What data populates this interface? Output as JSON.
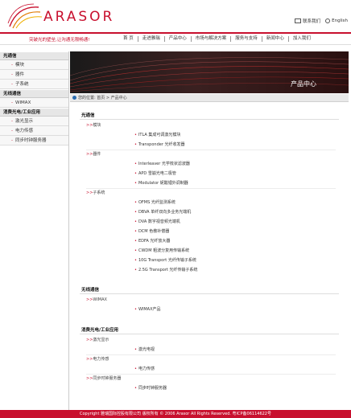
{
  "brand": {
    "logo_text": "ARASOR"
  },
  "top_links": {
    "contact": "联系我们",
    "english": "English"
  },
  "slogan": "突破光的壁垒,让沟通无限畅通!",
  "nav": [
    "首 页",
    "走进雅瑞",
    "产品中心",
    "市场与解决方案",
    "服务与支持",
    "新闻中心",
    "加入我们"
  ],
  "sidebar": {
    "groups": [
      {
        "title": "光通信",
        "items": [
          "模块",
          "器件",
          "子系统"
        ]
      },
      {
        "title": "无线通信",
        "items": [
          "WIMAX"
        ]
      },
      {
        "title": "消费光电/工业应用",
        "items": [
          "激光显示",
          "电力传感",
          "同步时钟服务器"
        ]
      }
    ]
  },
  "banner": {
    "title": "产品中心"
  },
  "breadcrumb": "您的位置: 首页 > 产品中心",
  "content": {
    "sections": [
      {
        "title": "光通信",
        "subs": [
          {
            "label": "模块",
            "rows": [
              "ITLA 集成可调激光模块",
              "Transponder 光纤收发器"
            ]
          },
          {
            "label": "器件",
            "rows": [
              "Interleaver 光学梳状滤波器",
              "APD 雪崩光电二极管",
              "Modulator 铌酸锂外调制器"
            ]
          },
          {
            "label": "子系统",
            "rows": [
              "OFMS 光纤监测系统",
              "DBVA 单纤双向多业务光端机",
              "DVA 数字视音频光端机",
              "DCM 色散补偿器",
              "EDFA 光纤放大器",
              "CWDM 粗波分复用传输系统",
              "10G Transport 光纤传输子系统",
              "2.5G Transport 光纤传输子系统"
            ]
          }
        ]
      },
      {
        "title": "无线通信",
        "subs": [
          {
            "label": "WIMAX",
            "rows": [
              "WIMAX产品"
            ]
          }
        ]
      },
      {
        "title": "消费光电/工业应用",
        "subs": [
          {
            "label": "激光显示",
            "rows": [
              "激光电视"
            ]
          },
          {
            "label": "电力传感",
            "rows": [
              "电力传感"
            ]
          },
          {
            "label": "同步时钟服务器",
            "rows": [
              "同步时钟服务器"
            ]
          }
        ]
      }
    ]
  },
  "sub_prefix": ">>",
  "bullet": "•",
  "footer": "Copyright  雅瑞国际控股有限公司 版权所有 © 2006 Arasor All Rights Reserved. 粤ICP备06114622号"
}
